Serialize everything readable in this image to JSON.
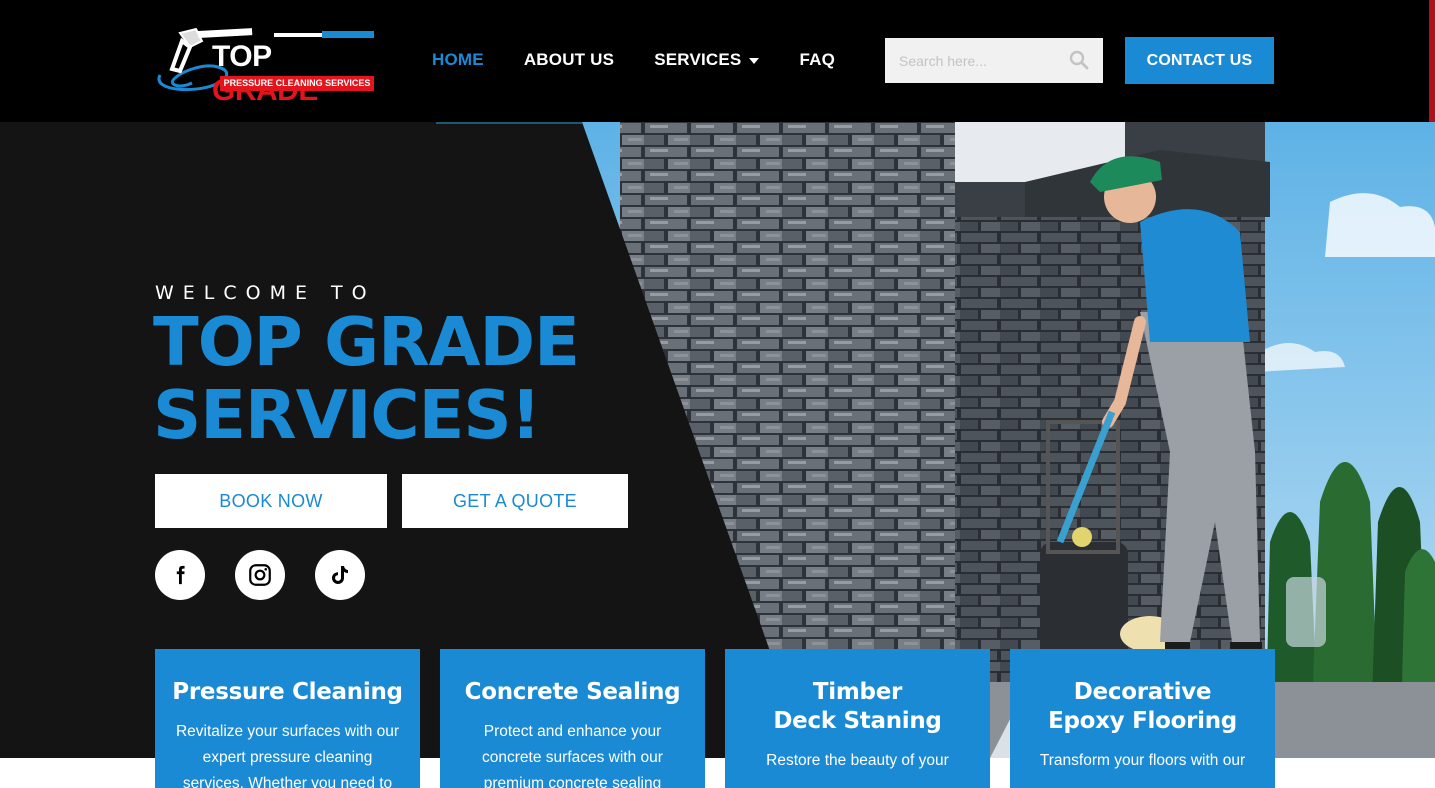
{
  "brand": {
    "name_part1": "TOP",
    "name_part2": "GRADE",
    "tagline": "PRESSURE CLEANING SERVICES"
  },
  "nav": {
    "items": [
      {
        "label": "HOME",
        "active": true
      },
      {
        "label": "ABOUT US"
      },
      {
        "label": "SERVICES",
        "has_dropdown": true
      },
      {
        "label": "FAQ"
      }
    ]
  },
  "search": {
    "placeholder": "Search here..."
  },
  "header": {
    "contact_label": "CONTACT US"
  },
  "hero": {
    "welcome": "WELCOME TO",
    "headline_line1": "TOP GRADE",
    "headline_line2": "SERVICES!",
    "book_label": "BOOK NOW",
    "quote_label": "GET A QUOTE"
  },
  "social": [
    "facebook-icon",
    "instagram-icon",
    "tiktok-icon"
  ],
  "services": [
    {
      "title_line1": "Pressure Cleaning",
      "title_line2": "",
      "description": "Revitalize your surfaces with our expert pressure cleaning services. Whether you need to"
    },
    {
      "title_line1": "Concrete Sealing",
      "title_line2": "",
      "description": "Protect and enhance your concrete surfaces with our premium concrete sealing"
    },
    {
      "title_line1": "Timber",
      "title_line2": "Deck Staning",
      "description": "Restore the beauty of your"
    },
    {
      "title_line1": "Decorative",
      "title_line2": "Epoxy Flooring",
      "description": "Transform your floors with our"
    }
  ],
  "colors": {
    "accent": "#1a8ad4",
    "brand_red": "#e2141c",
    "header_bg": "#000000",
    "hero_dark": "#141414"
  }
}
